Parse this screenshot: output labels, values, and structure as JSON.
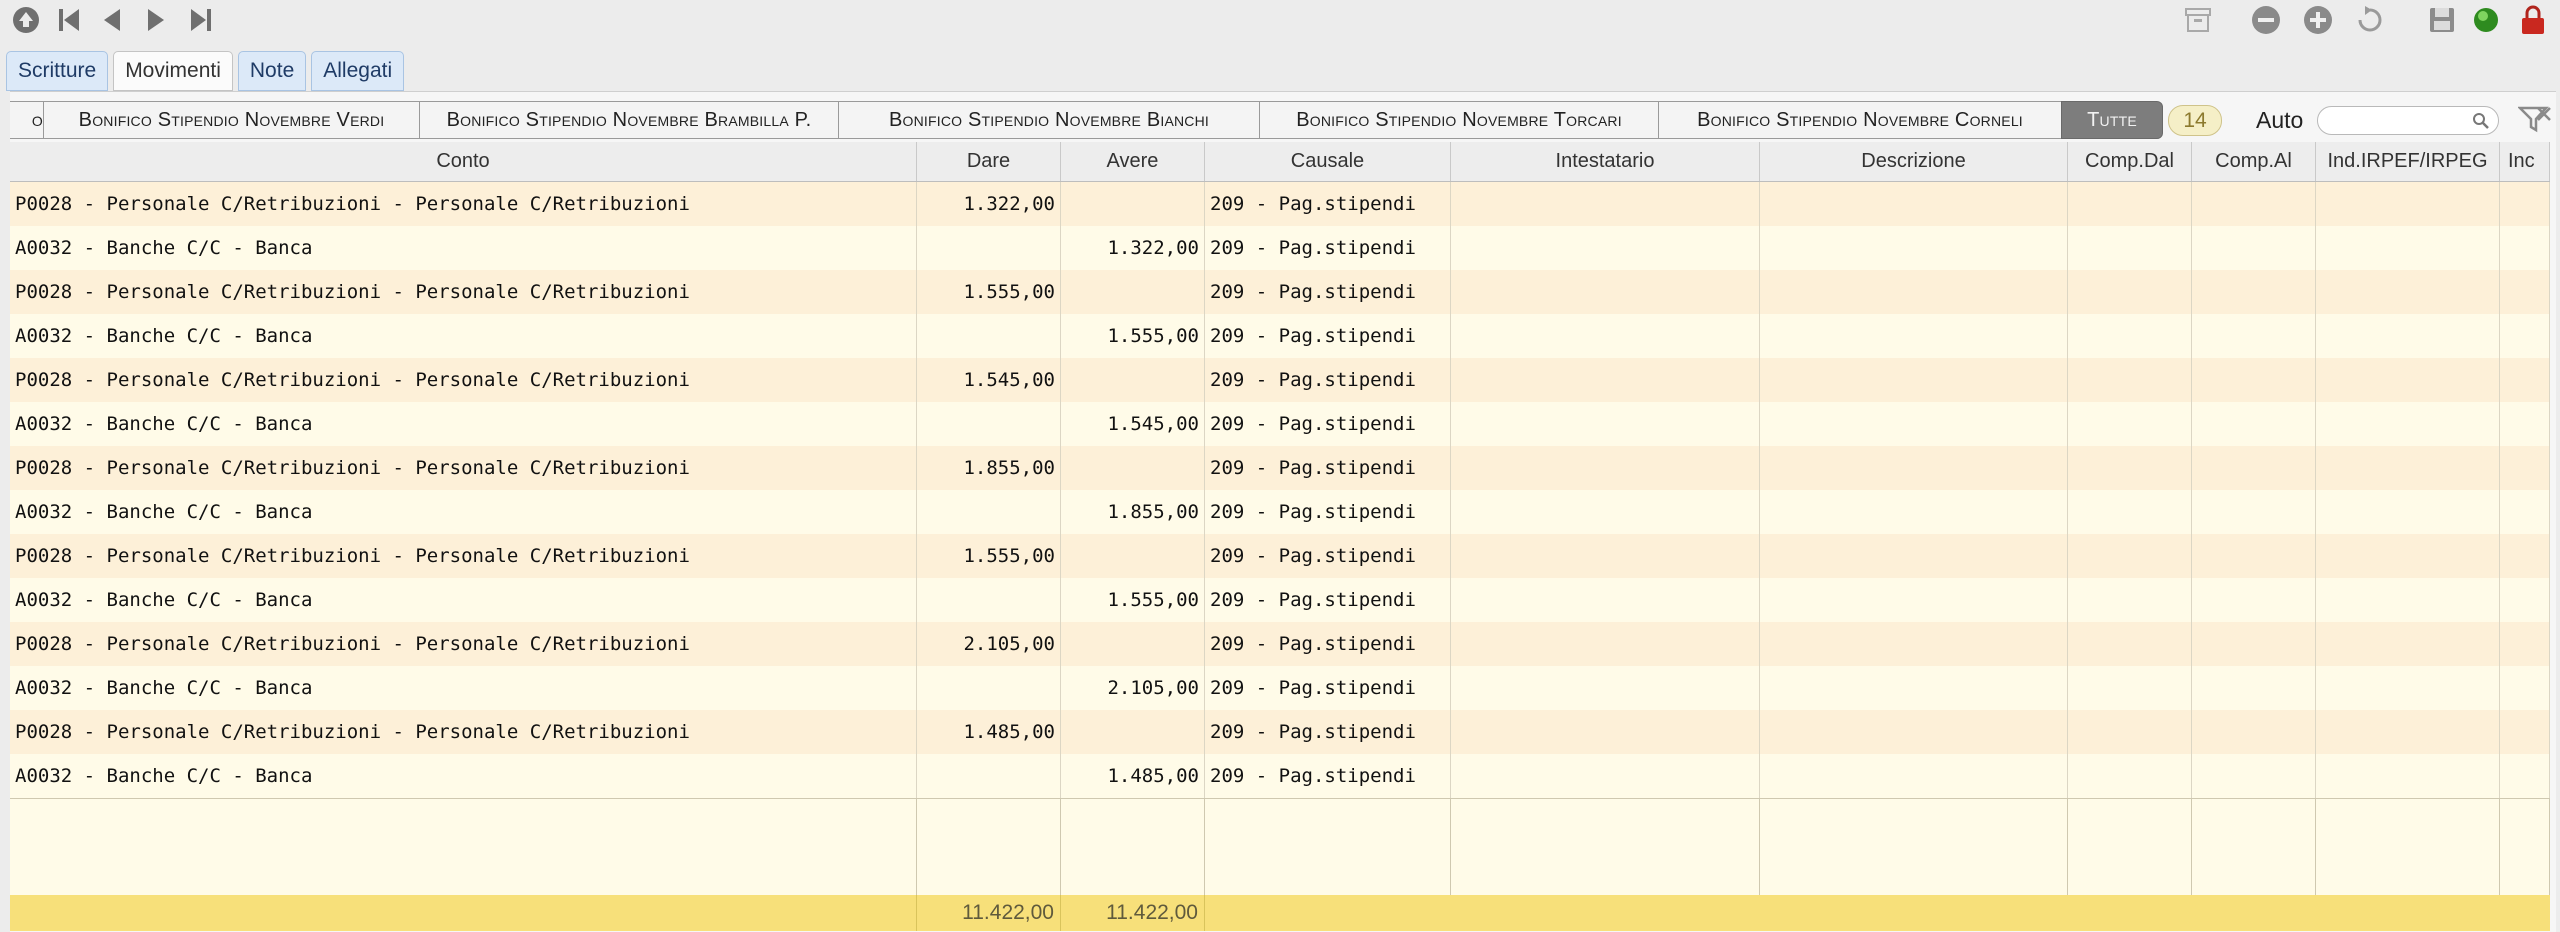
{
  "main_tabs": [
    {
      "label": "Scritture",
      "active": false
    },
    {
      "label": "Movimenti",
      "active": true
    },
    {
      "label": "Note",
      "active": false
    },
    {
      "label": "Allegati",
      "active": false
    }
  ],
  "record_tabs": [
    "o",
    "Bonifico Stipendio Novembre Verdi",
    "Bonifico Stipendio Novembre Brambilla P.",
    "Bonifico Stipendio Novembre Bianchi",
    "Bonifico Stipendio Novembre Torcari",
    "Bonifico Stipendio Novembre Corneli",
    "Tutte"
  ],
  "record_count": "14",
  "auto_label": "Auto",
  "search": {
    "value": "",
    "placeholder": ""
  },
  "columns": [
    "Conto",
    "Dare",
    "Avere",
    "Causale",
    "Intestatario",
    "Descrizione",
    "Comp.Dal",
    "Comp.Al",
    "Ind.IRPEF/IRPEG",
    "Inc"
  ],
  "rows": [
    [
      "P0028 - Personale C/Retribuzioni - Personale C/Retribuzioni",
      "1.322,00",
      "",
      "209 - Pag.stipendi",
      "",
      "",
      "",
      "",
      "",
      ""
    ],
    [
      "A0032 - Banche C/C - Banca",
      "",
      "1.322,00",
      "209 - Pag.stipendi",
      "",
      "",
      "",
      "",
      "",
      ""
    ],
    [
      "P0028 - Personale C/Retribuzioni - Personale C/Retribuzioni",
      "1.555,00",
      "",
      "209 - Pag.stipendi",
      "",
      "",
      "",
      "",
      "",
      ""
    ],
    [
      "A0032 - Banche C/C - Banca",
      "",
      "1.555,00",
      "209 - Pag.stipendi",
      "",
      "",
      "",
      "",
      "",
      ""
    ],
    [
      "P0028 - Personale C/Retribuzioni - Personale C/Retribuzioni",
      "1.545,00",
      "",
      "209 - Pag.stipendi",
      "",
      "",
      "",
      "",
      "",
      ""
    ],
    [
      "A0032 - Banche C/C - Banca",
      "",
      "1.545,00",
      "209 - Pag.stipendi",
      "",
      "",
      "",
      "",
      "",
      ""
    ],
    [
      "P0028 - Personale C/Retribuzioni - Personale C/Retribuzioni",
      "1.855,00",
      "",
      "209 - Pag.stipendi",
      "",
      "",
      "",
      "",
      "",
      ""
    ],
    [
      "A0032 - Banche C/C - Banca",
      "",
      "1.855,00",
      "209 - Pag.stipendi",
      "",
      "",
      "",
      "",
      "",
      ""
    ],
    [
      "P0028 - Personale C/Retribuzioni - Personale C/Retribuzioni",
      "1.555,00",
      "",
      "209 - Pag.stipendi",
      "",
      "",
      "",
      "",
      "",
      ""
    ],
    [
      "A0032 - Banche C/C - Banca",
      "",
      "1.555,00",
      "209 - Pag.stipendi",
      "",
      "",
      "",
      "",
      "",
      ""
    ],
    [
      "P0028 - Personale C/Retribuzioni - Personale C/Retribuzioni",
      "2.105,00",
      "",
      "209 - Pag.stipendi",
      "",
      "",
      "",
      "",
      "",
      ""
    ],
    [
      "A0032 - Banche C/C - Banca",
      "",
      "2.105,00",
      "209 - Pag.stipendi",
      "",
      "",
      "",
      "",
      "",
      ""
    ],
    [
      "P0028 - Personale C/Retribuzioni - Personale C/Retribuzioni",
      "1.485,00",
      "",
      "209 - Pag.stipendi",
      "",
      "",
      "",
      "",
      "",
      ""
    ],
    [
      "A0032 - Banche C/C - Banca",
      "",
      "1.485,00",
      "209 - Pag.stipendi",
      "",
      "",
      "",
      "",
      "",
      ""
    ]
  ],
  "totals": {
    "dare": "11.422,00",
    "avere": "11.422,00"
  },
  "colors": {
    "row_odd": "#fdf0d8",
    "row_even": "#fffbe8",
    "footer": "#f7e07a",
    "tab_active_all": "#7d7d7d"
  },
  "toolbar_icons": [
    "up-icon",
    "first-record-icon",
    "previous-record-icon",
    "next-record-icon",
    "last-record-icon",
    "archive-icon",
    "remove-icon",
    "add-icon",
    "revert-icon",
    "save-icon",
    "status-green-icon",
    "lock-icon"
  ]
}
